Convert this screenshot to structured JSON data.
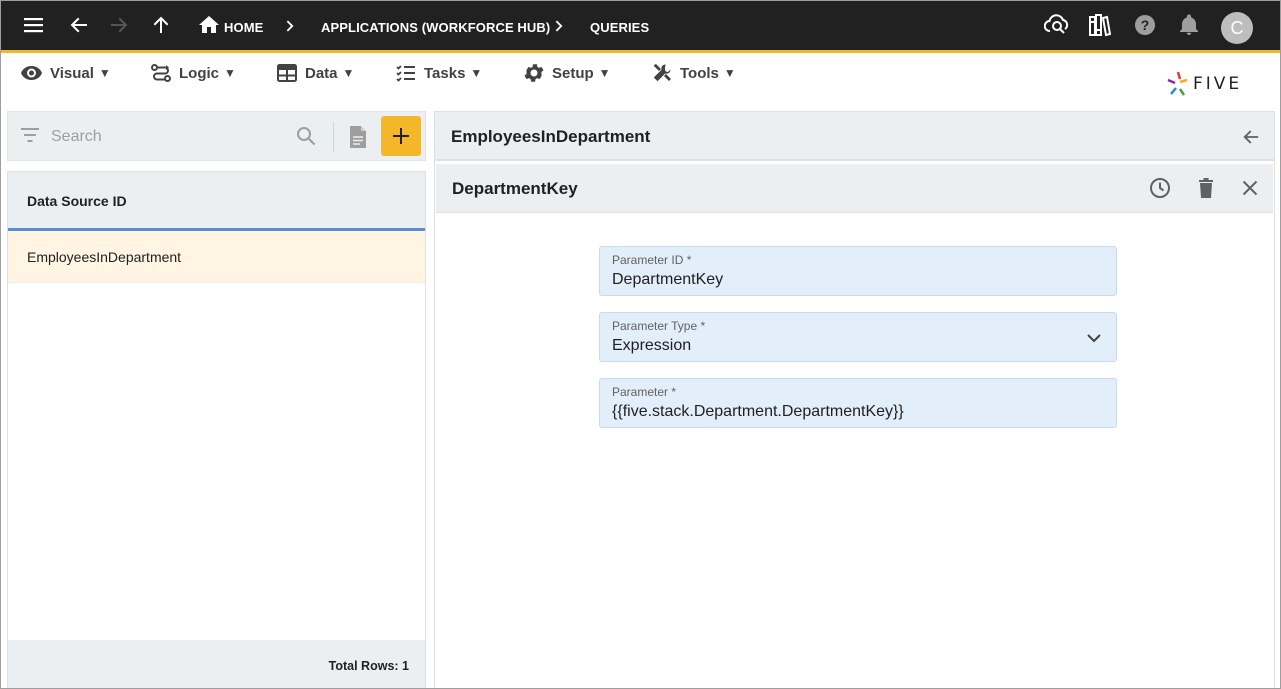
{
  "topbar": {
    "breadcrumbs": [
      "HOME",
      "APPLICATIONS (WORKFORCE HUB)",
      "QUERIES"
    ],
    "avatar_initial": "C",
    "icons": [
      "menu-icon",
      "back-arrow-icon",
      "forward-arrow-icon",
      "up-arrow-icon",
      "home-icon",
      "cloud-search-icon",
      "library-icon",
      "help-icon",
      "bell-icon"
    ]
  },
  "menu": {
    "items": [
      "Visual",
      "Logic",
      "Data",
      "Tasks",
      "Setup",
      "Tools"
    ],
    "caret": "▼"
  },
  "logo": {
    "text": "FIVE"
  },
  "search": {
    "placeholder": "Search"
  },
  "list": {
    "header": "Data Source ID",
    "rows": [
      "EmployeesInDepartment"
    ],
    "footer": "Total Rows: 1"
  },
  "detail": {
    "title": "EmployeesInDepartment",
    "form_title": "DepartmentKey",
    "fields": [
      {
        "label": "Parameter ID *",
        "value": "DepartmentKey"
      },
      {
        "label": "Parameter Type *",
        "value": "Expression"
      },
      {
        "label": "Parameter *",
        "value": "{{five.stack.Department.DepartmentKey}}"
      }
    ]
  },
  "colors": {
    "topbar_bg": "#212121",
    "accent": "#f5b72a",
    "selected_row": "#fff5e2",
    "field_bg": "#e3eefb",
    "header_underline": "#5b8bd0"
  }
}
